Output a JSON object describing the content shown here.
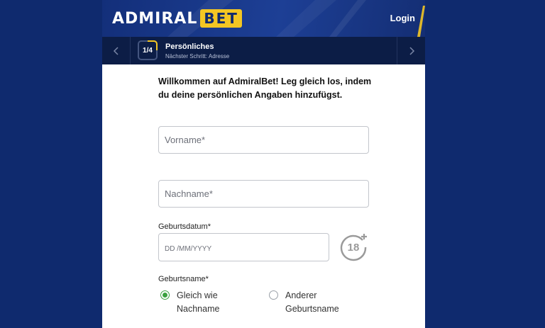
{
  "header": {
    "logo_part1": "ADMIRAL",
    "logo_part2": "BET",
    "login_label": "Login"
  },
  "stepper": {
    "step_badge": "1/4",
    "title": "Persönliches",
    "subtitle": "Nächster Schritt: Adresse"
  },
  "form": {
    "intro": "Willkommen auf AdmiralBet! Leg gleich los, indem du deine persönlichen Angaben hinzufügst.",
    "first_name_placeholder": "Vorname*",
    "last_name_placeholder": "Nachname*",
    "dob_label": "Geburtsdatum*",
    "dob_placeholder": "DD /MM/YYYY",
    "age_badge": "18+",
    "birth_name_label": "Geburtsname*",
    "birth_name_options": [
      {
        "label": "Gleich wie Nachname",
        "selected": true
      },
      {
        "label": "Anderer Geburtsname",
        "selected": false
      }
    ]
  },
  "colors": {
    "page_bg": "#0f2a6e",
    "header_bg": "#1d3f95",
    "stepbar_bg": "#0c1d46",
    "accent_yellow": "#f3c623",
    "radio_green": "#3aa13f"
  }
}
